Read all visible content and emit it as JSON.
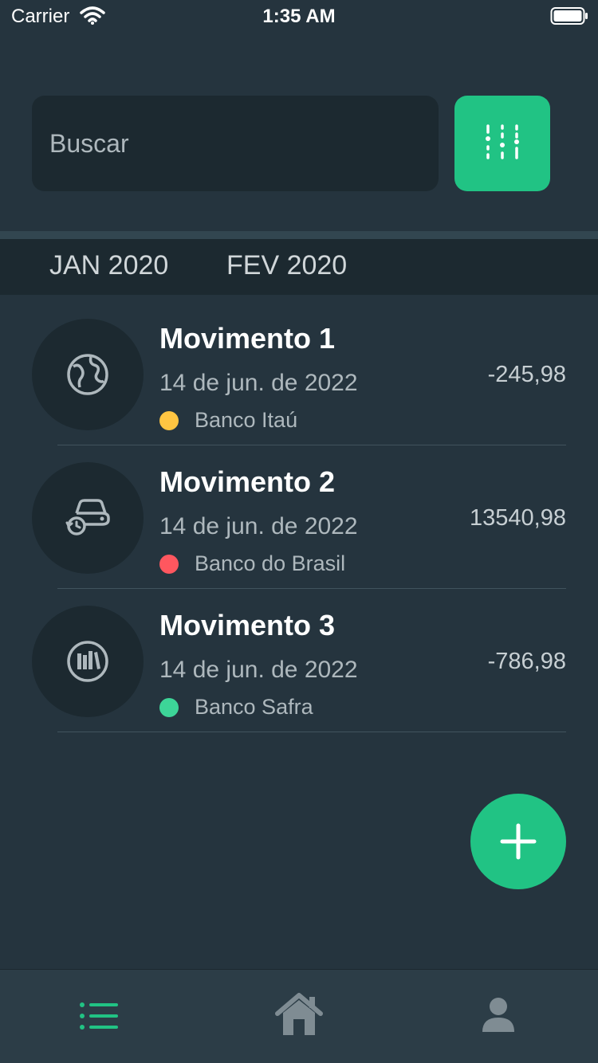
{
  "status_bar": {
    "carrier": "Carrier",
    "time": "1:35 AM",
    "icons": [
      "wifi-icon",
      "battery-icon"
    ]
  },
  "search": {
    "placeholder": "Buscar",
    "value": "",
    "filter_icon": "sliders-icon"
  },
  "months": {
    "tabs": [
      {
        "label": "JAN 2020"
      },
      {
        "label": "FEV 2020"
      }
    ]
  },
  "transactions": [
    {
      "title": "Movimento 1",
      "date": "14 de jun. de 2022",
      "bank": "Banco Itaú",
      "bank_color": "#ffc542",
      "amount": "-245,98",
      "icon": "globe-icon"
    },
    {
      "title": "Movimento 2",
      "date": "14 de jun. de 2022",
      "bank": "Banco do Brasil",
      "bank_color": "#ff575f",
      "amount": "13540,98",
      "icon": "car-history-icon"
    },
    {
      "title": "Movimento 3",
      "date": "14 de jun. de 2022",
      "bank": "Banco Safra",
      "bank_color": "#3dd598",
      "amount": "-786,98",
      "icon": "library-icon"
    }
  ],
  "fab": {
    "icon": "plus-icon"
  },
  "tab_bar": {
    "items": [
      {
        "icon": "list-icon",
        "active": true
      },
      {
        "icon": "home-icon",
        "active": false
      },
      {
        "icon": "user-icon",
        "active": false
      }
    ]
  },
  "colors": {
    "background": "#25343e",
    "surface_dark": "#1c2930",
    "accent": "#21c384",
    "tab_bar": "#2c3d47",
    "text_secondary": "#aeb8bd",
    "icon_inactive": "#7f8c93"
  }
}
